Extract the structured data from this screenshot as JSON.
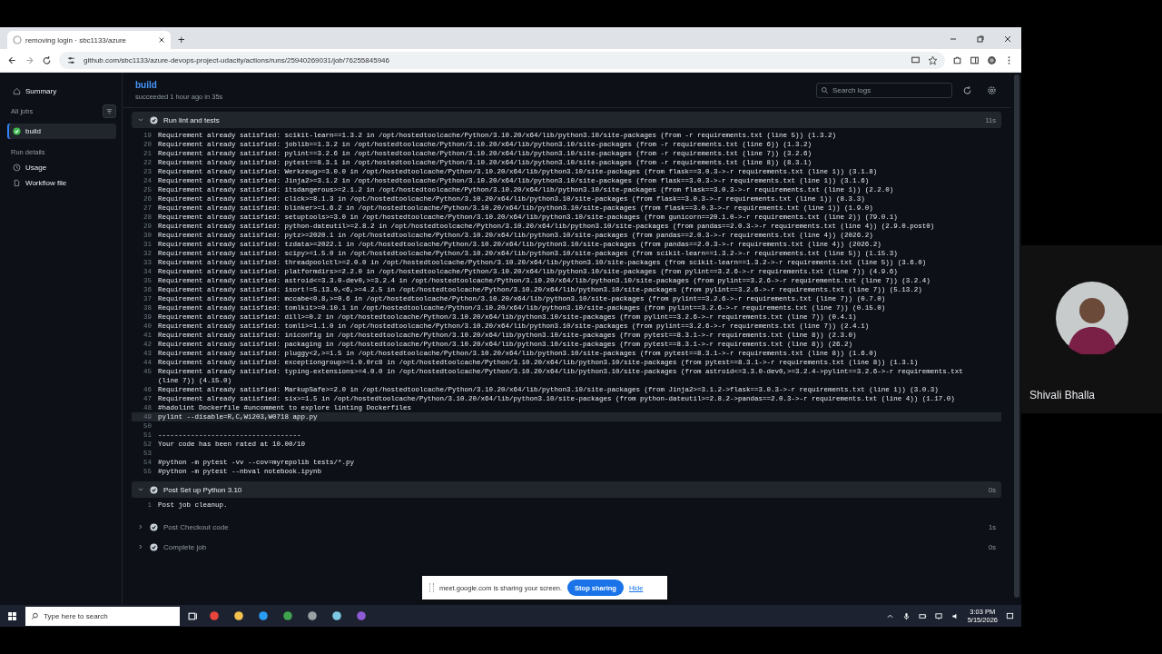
{
  "browser": {
    "tab_title": "removing login · sbc1133/azure",
    "new_tab": "+",
    "url": "github.com/sbc1133/azure-devops-project-udacity/actions/runs/25940269031/job/76255845946"
  },
  "sidebar": {
    "summary": "Summary",
    "all_jobs": "All jobs",
    "jobs": [
      {
        "label": "build",
        "selected": true
      }
    ],
    "run_details": "Run details",
    "details": [
      {
        "kind": "usage",
        "label": "Usage"
      },
      {
        "kind": "workflow",
        "label": "Workflow file"
      }
    ]
  },
  "job": {
    "title": "build",
    "subtitle": "succeeded 1 hour ago in 35s",
    "search_placeholder": "Search logs"
  },
  "steps": [
    {
      "name": "Run lint and tests",
      "duration": "11s",
      "expanded": true,
      "lines": [
        {
          "n": "19",
          "text": "Requirement already satisfied: scikit-learn==1.3.2 in /opt/hostedtoolcache/Python/3.10.20/x64/lib/python3.10/site-packages (from -r requirements.txt (line 5)) (1.3.2)"
        },
        {
          "n": "20",
          "text": "Requirement already satisfied: joblib==1.3.2 in /opt/hostedtoolcache/Python/3.10.20/x64/lib/python3.10/site-packages (from -r requirements.txt (line 6)) (1.3.2)"
        },
        {
          "n": "21",
          "text": "Requirement already satisfied: pylint==3.2.6 in /opt/hostedtoolcache/Python/3.10.20/x64/lib/python3.10/site-packages (from -r requirements.txt (line 7)) (3.2.6)"
        },
        {
          "n": "22",
          "text": "Requirement already satisfied: pytest==8.3.1 in /opt/hostedtoolcache/Python/3.10.20/x64/lib/python3.10/site-packages (from -r requirements.txt (line 8)) (8.3.1)"
        },
        {
          "n": "23",
          "text": "Requirement already satisfied: Werkzeug>=3.0.0 in /opt/hostedtoolcache/Python/3.10.20/x64/lib/python3.10/site-packages (from flask==3.0.3->-r requirements.txt (line 1)) (3.1.8)"
        },
        {
          "n": "24",
          "text": "Requirement already satisfied: Jinja2>=3.1.2 in /opt/hostedtoolcache/Python/3.10.20/x64/lib/python3.10/site-packages (from flask==3.0.3->-r requirements.txt (line 1)) (3.1.6)"
        },
        {
          "n": "25",
          "text": "Requirement already satisfied: itsdangerous>=2.1.2 in /opt/hostedtoolcache/Python/3.10.20/x64/lib/python3.10/site-packages (from flask==3.0.3->-r requirements.txt (line 1)) (2.2.0)"
        },
        {
          "n": "26",
          "text": "Requirement already satisfied: click>=8.1.3 in /opt/hostedtoolcache/Python/3.10.20/x64/lib/python3.10/site-packages (from flask==3.0.3->-r requirements.txt (line 1)) (8.3.3)"
        },
        {
          "n": "27",
          "text": "Requirement already satisfied: blinker>=1.6.2 in /opt/hostedtoolcache/Python/3.10.20/x64/lib/python3.10/site-packages (from flask==3.0.3->-r requirements.txt (line 1)) (1.9.0)"
        },
        {
          "n": "28",
          "text": "Requirement already satisfied: setuptools>=3.0 in /opt/hostedtoolcache/Python/3.10.20/x64/lib/python3.10/site-packages (from gunicorn==20.1.0->-r requirements.txt (line 2)) (79.0.1)"
        },
        {
          "n": "29",
          "text": "Requirement already satisfied: python-dateutil>=2.8.2 in /opt/hostedtoolcache/Python/3.10.20/x64/lib/python3.10/site-packages (from pandas==2.0.3->-r requirements.txt (line 4)) (2.9.0.post0)"
        },
        {
          "n": "30",
          "text": "Requirement already satisfied: pytz>=2020.1 in /opt/hostedtoolcache/Python/3.10.20/x64/lib/python3.10/site-packages (from pandas==2.0.3->-r requirements.txt (line 4)) (2026.2)"
        },
        {
          "n": "31",
          "text": "Requirement already satisfied: tzdata>=2022.1 in /opt/hostedtoolcache/Python/3.10.20/x64/lib/python3.10/site-packages (from pandas==2.0.3->-r requirements.txt (line 4)) (2026.2)"
        },
        {
          "n": "32",
          "text": "Requirement already satisfied: scipy>=1.5.0 in /opt/hostedtoolcache/Python/3.10.20/x64/lib/python3.10/site-packages (from scikit-learn==1.3.2->-r requirements.txt (line 5)) (1.15.3)"
        },
        {
          "n": "33",
          "text": "Requirement already satisfied: threadpoolctl>=2.0.0 in /opt/hostedtoolcache/Python/3.10.20/x64/lib/python3.10/site-packages (from scikit-learn==1.3.2->-r requirements.txt (line 5)) (3.6.0)"
        },
        {
          "n": "34",
          "text": "Requirement already satisfied: platformdirs>=2.2.0 in /opt/hostedtoolcache/Python/3.10.20/x64/lib/python3.10/site-packages (from pylint==3.2.6->-r requirements.txt (line 7)) (4.9.6)"
        },
        {
          "n": "35",
          "text": "Requirement already satisfied: astroid<=3.3.0-dev0,>=3.2.4 in /opt/hostedtoolcache/Python/3.10.20/x64/lib/python3.10/site-packages (from pylint==3.2.6->-r requirements.txt (line 7)) (3.2.4)"
        },
        {
          "n": "36",
          "text": "Requirement already satisfied: isort!=5.13.0,<6,>=4.2.5 in /opt/hostedtoolcache/Python/3.10.20/x64/lib/python3.10/site-packages (from pylint==3.2.6->-r requirements.txt (line 7)) (5.13.2)"
        },
        {
          "n": "37",
          "text": "Requirement already satisfied: mccabe<0.8,>=0.6 in /opt/hostedtoolcache/Python/3.10.20/x64/lib/python3.10/site-packages (from pylint==3.2.6->-r requirements.txt (line 7)) (0.7.0)"
        },
        {
          "n": "38",
          "text": "Requirement already satisfied: tomlkit>=0.10.1 in /opt/hostedtoolcache/Python/3.10.20/x64/lib/python3.10/site-packages (from pylint==3.2.6->-r requirements.txt (line 7)) (0.15.0)"
        },
        {
          "n": "39",
          "text": "Requirement already satisfied: dill>=0.2 in /opt/hostedtoolcache/Python/3.10.20/x64/lib/python3.10/site-packages (from pylint==3.2.6->-r requirements.txt (line 7)) (0.4.1)"
        },
        {
          "n": "40",
          "text": "Requirement already satisfied: tomli>=1.1.0 in /opt/hostedtoolcache/Python/3.10.20/x64/lib/python3.10/site-packages (from pylint==3.2.6->-r requirements.txt (line 7)) (2.4.1)"
        },
        {
          "n": "41",
          "text": "Requirement already satisfied: iniconfig in /opt/hostedtoolcache/Python/3.10.20/x64/lib/python3.10/site-packages (from pytest==8.3.1->-r requirements.txt (line 8)) (2.3.0)"
        },
        {
          "n": "42",
          "text": "Requirement already satisfied: packaging in /opt/hostedtoolcache/Python/3.10.20/x64/lib/python3.10/site-packages (from pytest==8.3.1->-r requirements.txt (line 8)) (26.2)"
        },
        {
          "n": "43",
          "text": "Requirement already satisfied: pluggy<2,>=1.5 in /opt/hostedtoolcache/Python/3.10.20/x64/lib/python3.10/site-packages (from pytest==8.3.1->-r requirements.txt (line 8)) (1.6.0)"
        },
        {
          "n": "44",
          "text": "Requirement already satisfied: exceptiongroup>=1.0.0rc8 in /opt/hostedtoolcache/Python/3.10.20/x64/lib/python3.10/site-packages (from pytest==8.3.1->-r requirements.txt (line 8)) (1.3.1)"
        },
        {
          "n": "45",
          "text": "Requirement already satisfied: typing-extensions>=4.0.0 in /opt/hostedtoolcache/Python/3.10.20/x64/lib/python3.10/site-packages (from astroid<=3.3.0-dev0,>=3.2.4->pylint==3.2.6->-r requirements.txt (line 7)) (4.15.0)"
        },
        {
          "n": "46",
          "text": "Requirement already satisfied: MarkupSafe>=2.0 in /opt/hostedtoolcache/Python/3.10.20/x64/lib/python3.10/site-packages (from Jinja2>=3.1.2->flask==3.0.3->-r requirements.txt (line 1)) (3.0.3)"
        },
        {
          "n": "47",
          "text": "Requirement already satisfied: six>=1.5 in /opt/hostedtoolcache/Python/3.10.20/x64/lib/python3.10/site-packages (from python-dateutil>=2.8.2->pandas==2.0.3->-r requirements.txt (line 4)) (1.17.0)"
        },
        {
          "n": "48",
          "text": "#hadolint Dockerfile #uncomment to explore linting Dockerfiles"
        },
        {
          "n": "49",
          "text": "pylint --disable=R,C,W1203,W0718 app.py",
          "highlighted": true
        },
        {
          "n": "50"
        },
        {
          "n": "51",
          "text": "-----------------------------------"
        },
        {
          "n": "52",
          "text": "Your code has been rated at 10.00/10"
        },
        {
          "n": "53"
        },
        {
          "n": "54",
          "text": "#python -m pytest -vv --cov=myrepolib tests/*.py"
        },
        {
          "n": "55",
          "text": "#python -m pytest --nbval notebook.ipynb"
        }
      ]
    },
    {
      "name": "Post Set up Python 3.10",
      "duration": "0s",
      "expanded": true,
      "lines": [
        {
          "n": "1",
          "text": "Post job cleanup."
        }
      ]
    },
    {
      "name": "Post Checkout code",
      "duration": "1s",
      "expanded": false
    },
    {
      "name": "Complete job",
      "duration": "0s",
      "expanded": false
    }
  ],
  "share_bar": {
    "message": "meet.google.com is sharing your screen.",
    "stop": "Stop sharing",
    "hide": "Hide"
  },
  "taskbar": {
    "search_placeholder": "Type here to search",
    "time": "3:03 PM",
    "date": "5/15/2026"
  },
  "participant": {
    "name": "Shivali Bhalla"
  }
}
